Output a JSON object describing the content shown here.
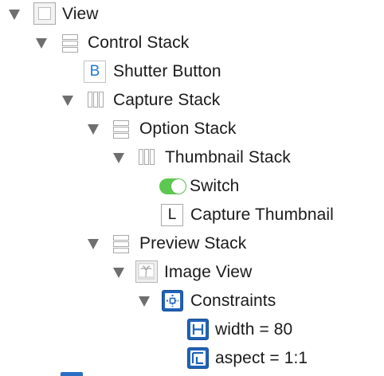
{
  "tree": {
    "view": {
      "label": "View",
      "icon": "view-icon",
      "expanded": true
    },
    "control_stack": {
      "label": "Control Stack",
      "icon": "vertical-stack-icon",
      "expanded": true
    },
    "shutter_button": {
      "label": "Shutter Button",
      "icon": "button-icon",
      "icon_glyph": "B"
    },
    "capture_stack": {
      "label": "Capture Stack",
      "icon": "horizontal-stack-icon",
      "expanded": true
    },
    "option_stack": {
      "label": "Option Stack",
      "icon": "vertical-stack-icon",
      "expanded": true
    },
    "thumbnail_stack": {
      "label": "Thumbnail Stack",
      "icon": "horizontal-stack-icon",
      "expanded": true
    },
    "switch": {
      "label": "Switch",
      "icon": "switch-icon"
    },
    "capture_thumbnail": {
      "label": "Capture Thumbnail",
      "icon": "label-icon",
      "icon_glyph": "L"
    },
    "preview_stack": {
      "label": "Preview Stack",
      "icon": "vertical-stack-icon",
      "expanded": true
    },
    "image_view": {
      "label": "Image View",
      "icon": "image-view-icon",
      "expanded": true
    },
    "constraints": {
      "label": "Constraints",
      "icon": "constraints-icon",
      "expanded": true
    },
    "width_constraint": {
      "label": "width = 80",
      "icon": "width-constraint-icon"
    },
    "aspect_constraint": {
      "label": "aspect = 1:1",
      "icon": "aspect-constraint-icon"
    }
  },
  "colors": {
    "disclosure": "#6e6e6e",
    "switch_on": "#5cc84f",
    "constraint_blue": "#1f63b8",
    "button_glyph": "#1e7bd9"
  }
}
